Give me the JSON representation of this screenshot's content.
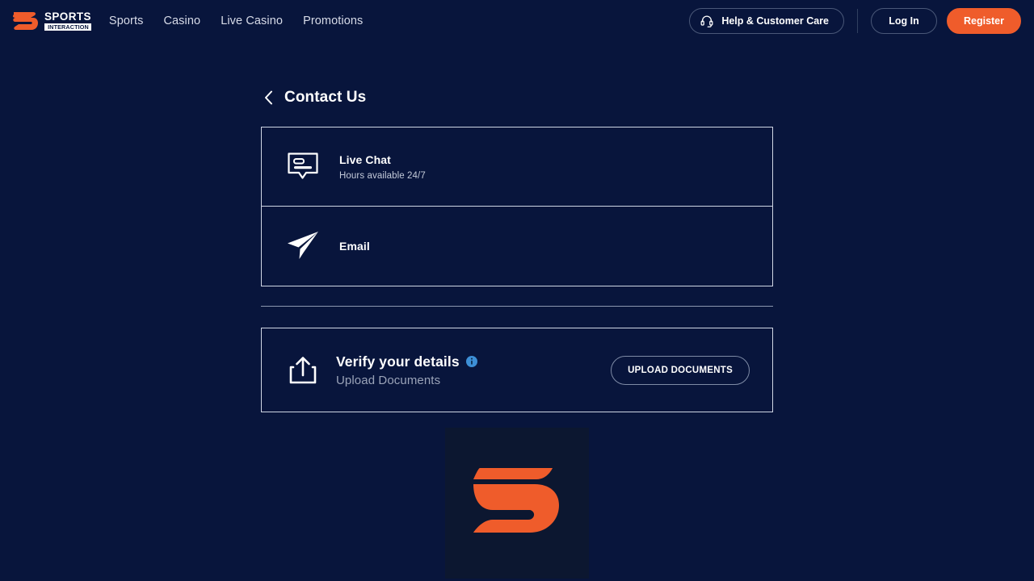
{
  "theme": {
    "background": "#08153c",
    "accent_orange": "#ef5c2b",
    "border_light": "#cfd6e4",
    "info_blue": "#3d8fd6",
    "muted_text": "#9aa3b8",
    "tile_background": "#0c1730"
  },
  "header": {
    "logo": {
      "name": "sports-interaction",
      "word_top": "SPORTS",
      "word_bottom": "INTERACTION"
    },
    "nav": [
      {
        "label": "Sports"
      },
      {
        "label": "Casino"
      },
      {
        "label": "Live Casino"
      },
      {
        "label": "Promotions"
      }
    ],
    "help_button": {
      "label": "Help & Customer Care",
      "icon": "headset-icon"
    },
    "login_button": {
      "label": "Log In"
    },
    "register_button": {
      "label": "Register"
    }
  },
  "page": {
    "back_icon": "chevron-left-icon",
    "title": "Contact Us"
  },
  "contact_options": [
    {
      "icon": "chat-bubble-icon",
      "title": "Live Chat",
      "subtitle": "Hours available 24/7"
    },
    {
      "icon": "paper-plane-icon",
      "title": "Email",
      "subtitle": ""
    }
  ],
  "verify": {
    "icon": "upload-icon",
    "title": "Verify your details",
    "info_icon": "info-icon",
    "subtitle": "Upload Documents",
    "button_label": "UPLOAD DOCUMENTS"
  },
  "brand_tile": {
    "icon": "sports-interaction-s-logo"
  }
}
